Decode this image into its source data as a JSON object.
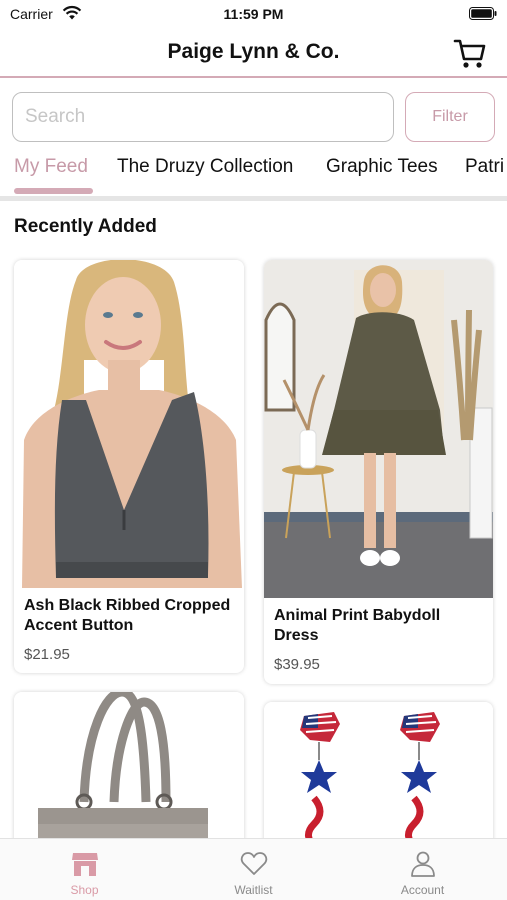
{
  "status_bar": {
    "carrier": "Carrier",
    "time": "11:59 PM"
  },
  "header": {
    "title": "Paige Lynn & Co."
  },
  "search": {
    "placeholder": "Search",
    "value": "",
    "filter_label": "Filter"
  },
  "category_tabs": [
    {
      "label": "My Feed",
      "active": true
    },
    {
      "label": "The Druzy Collection",
      "active": false
    },
    {
      "label": "Graphic Tees",
      "active": false
    },
    {
      "label": "Patri",
      "active": false
    }
  ],
  "feed": {
    "section_title": "Recently Added",
    "products": [
      {
        "name": "Ash Black Ribbed Cropped Accent Button",
        "price": "$21.95",
        "image": "ribbed-cropped-top"
      },
      {
        "name": "Animal Print Babydoll Dress",
        "price": "$39.95",
        "image": "babydoll-dress"
      },
      {
        "name": "",
        "price": "",
        "image": "gray-tote-bag"
      },
      {
        "name": "",
        "price": "",
        "image": "americana-earrings"
      }
    ]
  },
  "bottom_nav": [
    {
      "label": "Shop",
      "icon": "storefront-icon",
      "active": true
    },
    {
      "label": "Waitlist",
      "icon": "heart-icon",
      "active": false
    },
    {
      "label": "Account",
      "icon": "person-icon",
      "active": false
    }
  ],
  "colors": {
    "accent": "#d4aab6",
    "accent_text": "#c79aa8",
    "active_tab_icon": "#d99aa6"
  }
}
